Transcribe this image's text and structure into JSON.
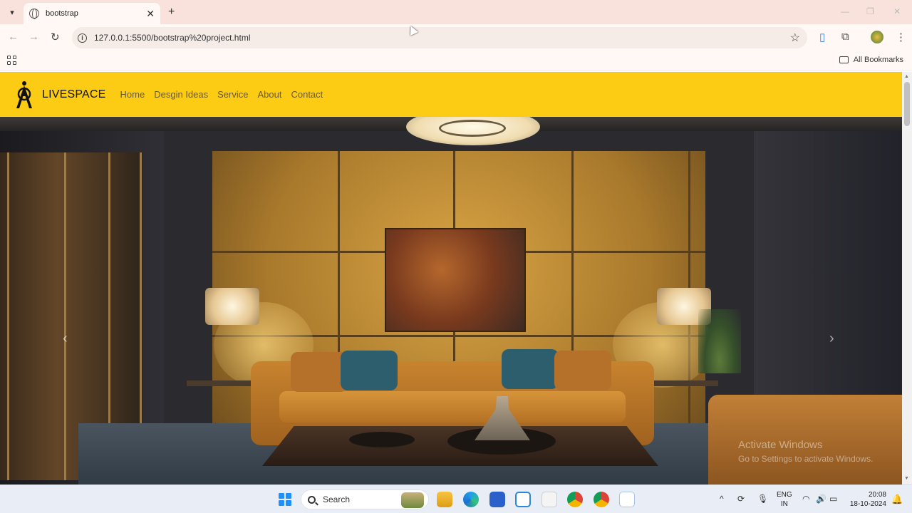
{
  "browser": {
    "tab_title": "bootstrap",
    "url": "127.0.0.1:5500/bootstrap%20project.html",
    "bookmarks_label": "All Bookmarks"
  },
  "site": {
    "brand": "LIVESPACE",
    "nav": [
      "Home",
      "Desgin Ideas",
      "Service",
      "About",
      "Contact"
    ],
    "nav_color": "#6b5a2a",
    "navbar_color": "#fccb13"
  },
  "watermark": {
    "line1": "Activate Windows",
    "line2": "Go to Settings to activate Windows."
  },
  "taskbar": {
    "search_label": "Search",
    "lang_line1": "ENG",
    "lang_line2": "IN",
    "time": "20:08",
    "date": "18-10-2024"
  },
  "icons": {
    "carousel_prev": "‹",
    "carousel_next": "›"
  }
}
